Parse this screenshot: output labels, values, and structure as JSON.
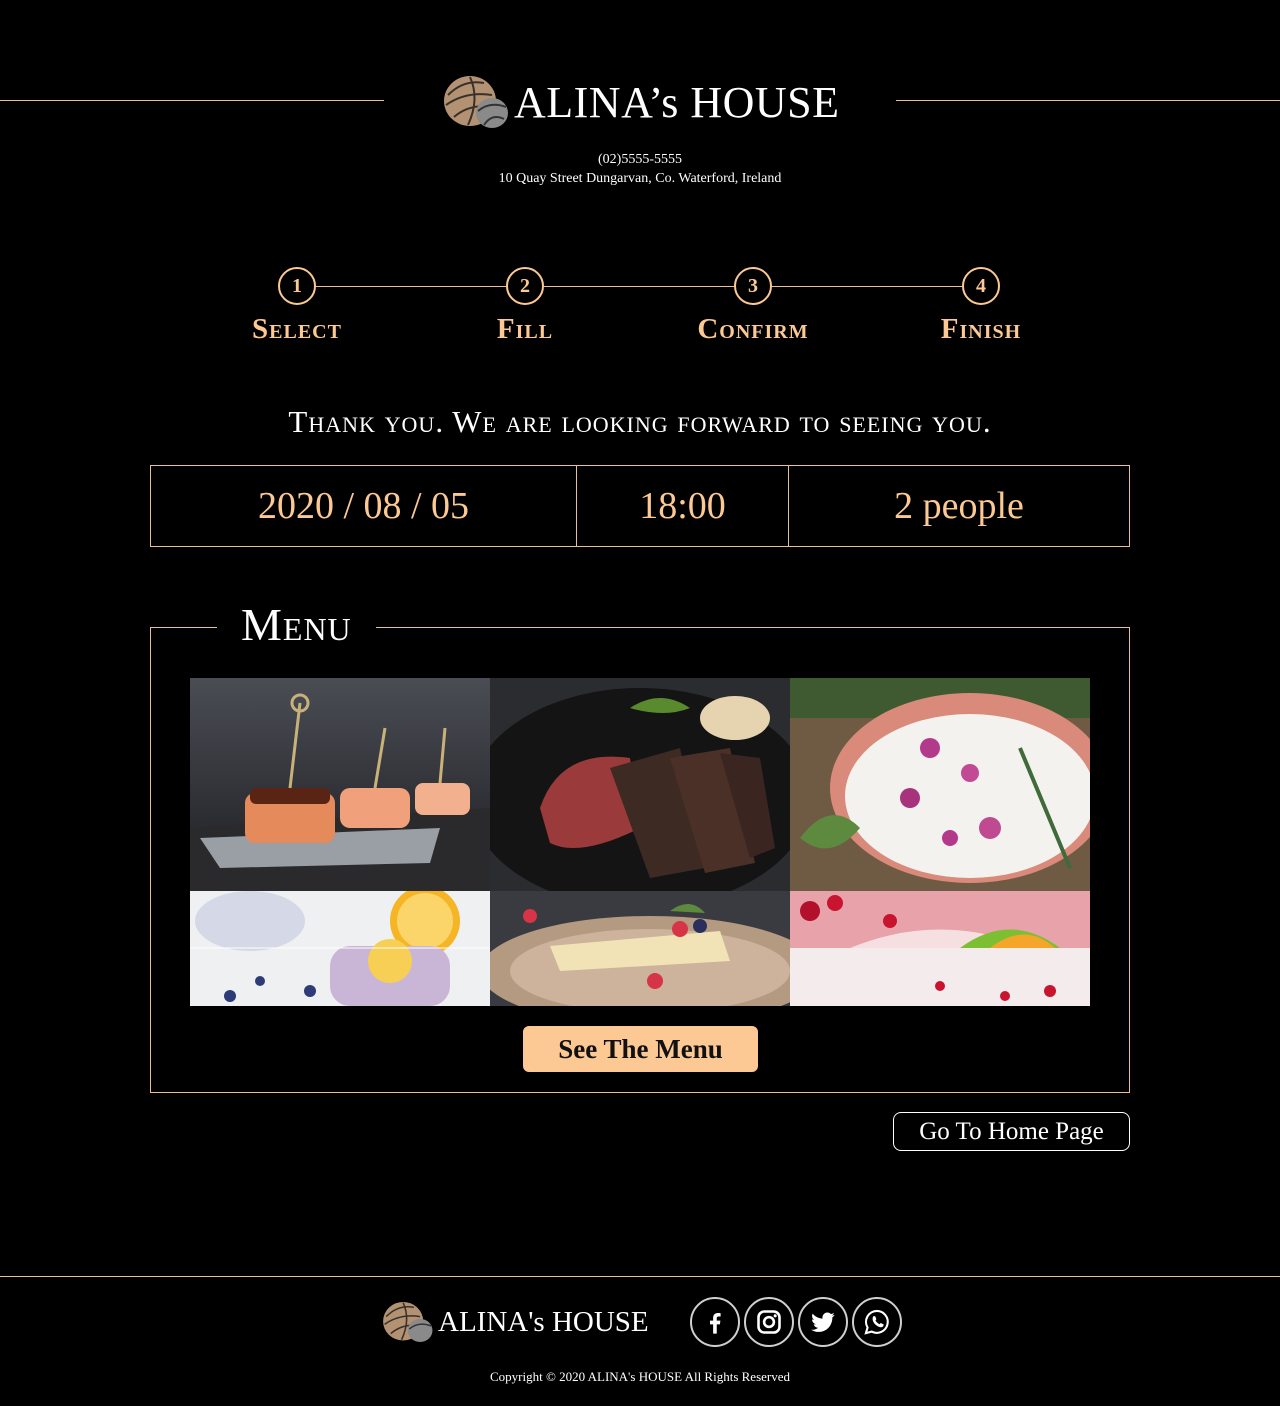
{
  "header": {
    "brand_name": "ALINA’s HOUSE",
    "phone": "(02)5555-5555",
    "address": "10 Quay Street Dungarvan, Co. Waterford, Ireland"
  },
  "steps": [
    {
      "number": "1",
      "label": "Select"
    },
    {
      "number": "2",
      "label": "Fill"
    },
    {
      "number": "3",
      "label": "Confirm"
    },
    {
      "number": "4",
      "label": "Finish"
    }
  ],
  "thanks": "Thank you. We are looking forward to seeing you.",
  "reservation": {
    "date": "2020 / 08 / 05",
    "time": "18:00",
    "people": "2 people"
  },
  "menu": {
    "title": "Menu",
    "button_label": "See The Menu",
    "images": [
      "salmon-skewers",
      "sliced-steak",
      "yogurt-soup-with-flowers",
      "lemon-berry-drinks",
      "cheesecake-with-berries",
      "cranberry-cocktail"
    ]
  },
  "home_button": "Go To Home Page",
  "footer": {
    "brand_name": "ALINA's HOUSE",
    "social": [
      "facebook-icon",
      "instagram-icon",
      "twitter-icon",
      "whatsapp-icon"
    ],
    "copyright": "Copyright © 2020 ALINA's HOUSE All Rights Reserved"
  },
  "colors": {
    "background": "#000000",
    "accent": "#fcc893",
    "line": "#e9c199"
  }
}
